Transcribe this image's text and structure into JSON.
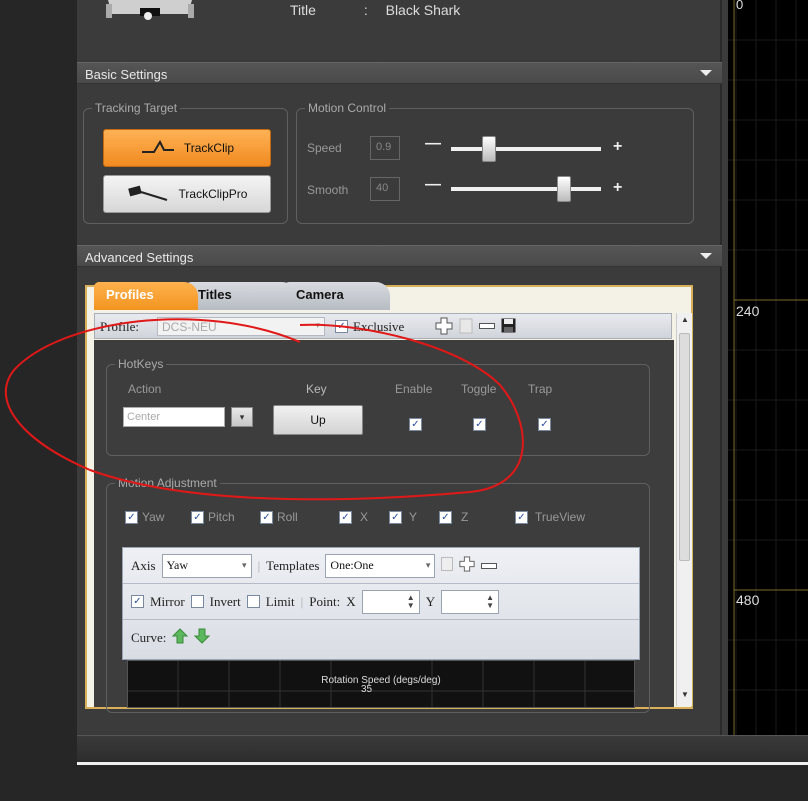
{
  "header": {
    "title_label": "Title",
    "title_separator": ":",
    "title_value": "Black Shark"
  },
  "basic_settings": {
    "label": "Basic Settings",
    "tracking_target": {
      "legend": "Tracking Target",
      "options": [
        {
          "label": "TrackClip",
          "active": true
        },
        {
          "label": "TrackClipPro",
          "active": false
        }
      ]
    },
    "motion_control": {
      "legend": "Motion Control",
      "speed": {
        "label": "Speed",
        "value": "0.9",
        "level": 0.25
      },
      "smooth": {
        "label": "Smooth",
        "value": "40",
        "level": 0.75
      },
      "minus": "—",
      "plus": "+"
    }
  },
  "advanced_settings": {
    "label": "Advanced Settings",
    "tabs": [
      {
        "label": "Profiles",
        "active": true
      },
      {
        "label": "Titles"
      },
      {
        "label": "Camera"
      }
    ],
    "profile": {
      "label": "Profile:",
      "value": "DCS-NEU",
      "exclusive_label": "Exclusive",
      "exclusive": true
    },
    "hotkeys": {
      "legend": "HotKeys",
      "headers": {
        "action": "Action",
        "key": "Key",
        "enable": "Enable",
        "toggle": "Toggle",
        "trap": "Trap"
      },
      "action_value": "Center",
      "key_value": "Up",
      "enable": true,
      "toggle": true,
      "trap": true
    },
    "motion_adjustment": {
      "legend": "Motion Adjustment",
      "axes": [
        {
          "label": "Yaw",
          "checked": true
        },
        {
          "label": "Pitch",
          "checked": true
        },
        {
          "label": "Roll",
          "checked": true
        },
        {
          "label": "X",
          "checked": true
        },
        {
          "label": "Y",
          "checked": true
        },
        {
          "label": "Z",
          "checked": true
        },
        {
          "label": "TrueView",
          "checked": true
        }
      ],
      "axis_label": "Axis",
      "axis_value": "Yaw",
      "templates_label": "Templates",
      "templates_value": "One:One",
      "mirror_label": "Mirror",
      "mirror": true,
      "invert_label": "Invert",
      "invert": false,
      "limit_label": "Limit",
      "limit": false,
      "point_label": "Point:",
      "x_label": "X",
      "y_label": "Y",
      "curve_label": "Curve:",
      "graph_title": "Rotation Speed (degs/deg)",
      "graph_value": "35"
    }
  },
  "right_pane": {
    "labels": [
      "0",
      "240",
      "480"
    ]
  },
  "colors": {
    "active_orange": "#f7a23c",
    "panel": "#3b3b3b",
    "accent_border": "#d8b05a",
    "annotation_red": "#e01818"
  }
}
